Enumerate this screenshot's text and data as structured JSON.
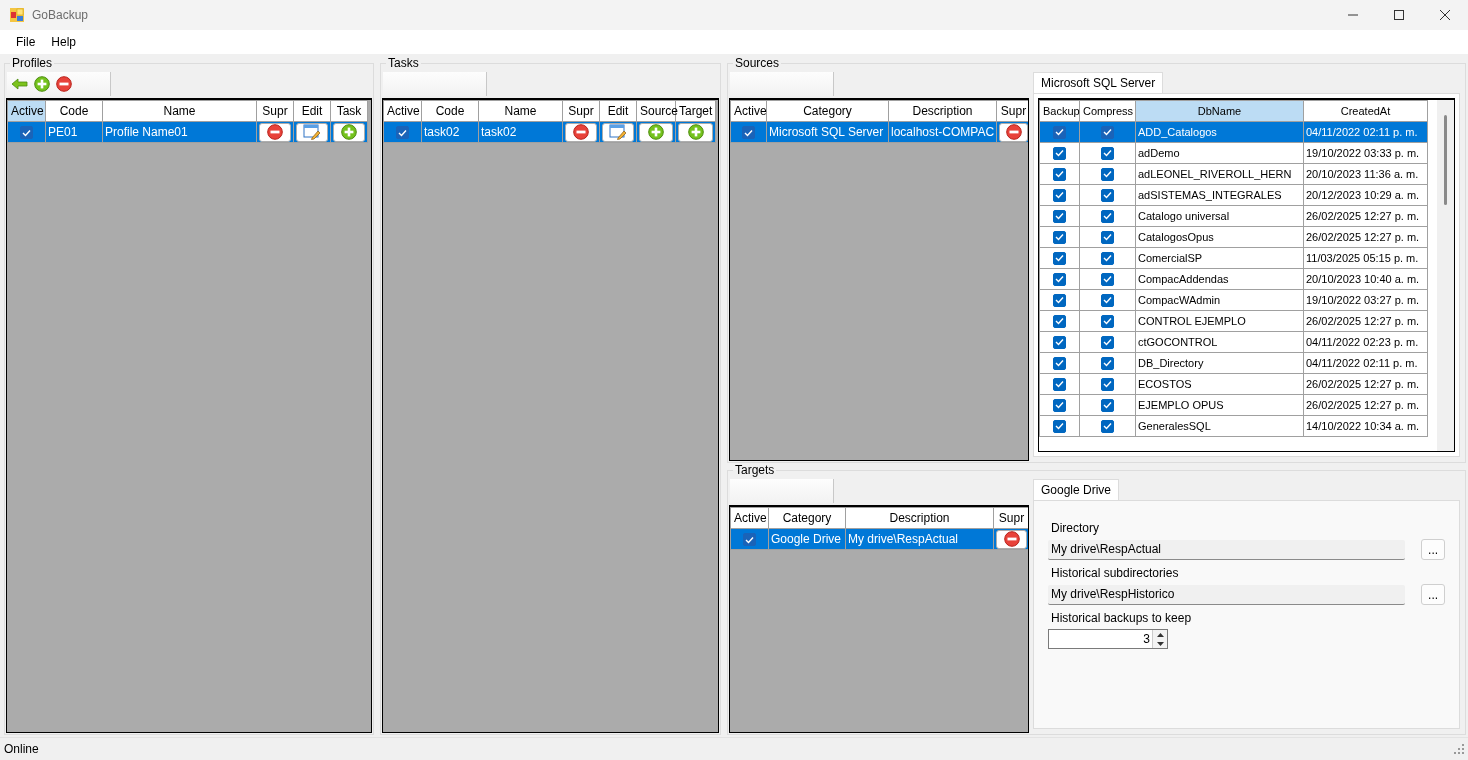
{
  "window": {
    "title": "GoBackup"
  },
  "menu": [
    {
      "label": "File"
    },
    {
      "label": "Help"
    }
  ],
  "profiles": {
    "title": "Profiles",
    "toolbar": [
      {
        "kind": "back"
      },
      {
        "kind": "add"
      },
      {
        "kind": "remove"
      }
    ],
    "columns": [
      {
        "label": "Active",
        "kind": "check",
        "highlighted": true
      },
      {
        "label": "Code",
        "kind": "text",
        "highlighted": false
      },
      {
        "label": "Name",
        "kind": "text",
        "highlighted": false
      },
      {
        "label": "Supr",
        "kind": "remove",
        "highlighted": false
      },
      {
        "label": "Edit",
        "kind": "edit",
        "highlighted": false
      },
      {
        "label": "Task",
        "kind": "add",
        "highlighted": false
      }
    ],
    "rows": [
      {
        "selected": true,
        "cells": [
          {
            "checked": true
          },
          "PE01",
          "Profile Name01"
        ]
      }
    ]
  },
  "tasks": {
    "title": "Tasks",
    "columns": [
      {
        "label": "Active",
        "kind": "check",
        "highlighted": false
      },
      {
        "label": "Code",
        "kind": "text",
        "highlighted": false
      },
      {
        "label": "Name",
        "kind": "text",
        "highlighted": false
      },
      {
        "label": "Supr",
        "kind": "remove",
        "highlighted": false
      },
      {
        "label": "Edit",
        "kind": "edit",
        "highlighted": false
      },
      {
        "label": "Source",
        "kind": "add",
        "highlighted": false
      },
      {
        "label": "Target",
        "kind": "add",
        "highlighted": false
      }
    ],
    "rows": [
      {
        "selected": true,
        "cells": [
          {
            "checked": true
          },
          "task02",
          "task02"
        ]
      }
    ]
  },
  "sources": {
    "title": "Sources",
    "columns": [
      {
        "label": "Active",
        "kind": "check",
        "highlighted": false
      },
      {
        "label": "Category",
        "kind": "text",
        "highlighted": false
      },
      {
        "label": "Description",
        "kind": "text",
        "highlighted": false
      },
      {
        "label": "Supr",
        "kind": "remove",
        "highlighted": false
      }
    ],
    "rows": [
      {
        "selected": true,
        "cells": [
          {
            "checked": true
          },
          "Microsoft SQL Server",
          "localhost-COMPAC"
        ]
      }
    ],
    "detail": {
      "tab": "Microsoft SQL Server",
      "columns": [
        {
          "label": "Backup",
          "kind": "check",
          "highlighted": false
        },
        {
          "label": "Compress",
          "kind": "check",
          "highlighted": false
        },
        {
          "label": "DbName",
          "kind": "text",
          "highlighted": true
        },
        {
          "label": "CreatedAt",
          "kind": "text",
          "highlighted": false
        }
      ],
      "rows": [
        {
          "selected": true,
          "cells": [
            {
              "checked": true
            },
            {
              "checked": true
            },
            "ADD_Catalogos",
            "04/11/2022 02:11 p. m."
          ]
        },
        {
          "selected": false,
          "cells": [
            {
              "checked": true
            },
            {
              "checked": true
            },
            "adDemo",
            "19/10/2022 03:33 p. m."
          ]
        },
        {
          "selected": false,
          "cells": [
            {
              "checked": true
            },
            {
              "checked": true
            },
            "adLEONEL_RIVEROLL_HERN",
            "20/10/2023 11:36 a. m."
          ]
        },
        {
          "selected": false,
          "cells": [
            {
              "checked": true
            },
            {
              "checked": true
            },
            "adSISTEMAS_INTEGRALES",
            "20/12/2023 10:29 a. m."
          ]
        },
        {
          "selected": false,
          "cells": [
            {
              "checked": true
            },
            {
              "checked": true
            },
            "Catalogo universal",
            "26/02/2025 12:27 p. m."
          ]
        },
        {
          "selected": false,
          "cells": [
            {
              "checked": true
            },
            {
              "checked": true
            },
            "CatalogosOpus",
            "26/02/2025 12:27 p. m."
          ]
        },
        {
          "selected": false,
          "cells": [
            {
              "checked": true
            },
            {
              "checked": true
            },
            "ComercialSP",
            "11/03/2025 05:15 p. m."
          ]
        },
        {
          "selected": false,
          "cells": [
            {
              "checked": true
            },
            {
              "checked": true
            },
            "CompacAddendas",
            "20/10/2023 10:40 a. m."
          ]
        },
        {
          "selected": false,
          "cells": [
            {
              "checked": true
            },
            {
              "checked": true
            },
            "CompacWAdmin",
            "19/10/2022 03:27 p. m."
          ]
        },
        {
          "selected": false,
          "cells": [
            {
              "checked": true
            },
            {
              "checked": true
            },
            "CONTROL EJEMPLO",
            "26/02/2025 12:27 p. m."
          ]
        },
        {
          "selected": false,
          "cells": [
            {
              "checked": true
            },
            {
              "checked": true
            },
            "ctGOCONTROL",
            "04/11/2022 02:23 p. m."
          ]
        },
        {
          "selected": false,
          "cells": [
            {
              "checked": true
            },
            {
              "checked": true
            },
            "DB_Directory",
            "04/11/2022 02:11 p. m."
          ]
        },
        {
          "selected": false,
          "cells": [
            {
              "checked": true
            },
            {
              "checked": true
            },
            "ECOSTOS",
            "26/02/2025 12:27 p. m."
          ]
        },
        {
          "selected": false,
          "cells": [
            {
              "checked": true
            },
            {
              "checked": true
            },
            "EJEMPLO OPUS",
            "26/02/2025 12:27 p. m."
          ]
        },
        {
          "selected": false,
          "cells": [
            {
              "checked": true
            },
            {
              "checked": true
            },
            "GeneralesSQL",
            "14/10/2022 10:34 a. m."
          ]
        }
      ]
    }
  },
  "targets": {
    "title": "Targets",
    "columns": [
      {
        "label": "Active",
        "kind": "check",
        "highlighted": false
      },
      {
        "label": "Category",
        "kind": "text",
        "highlighted": false
      },
      {
        "label": "Description",
        "kind": "text",
        "highlighted": false
      },
      {
        "label": "Supr",
        "kind": "remove",
        "highlighted": false
      }
    ],
    "rows": [
      {
        "selected": true,
        "cells": [
          {
            "checked": true
          },
          "Google Drive",
          "My drive\\RespActual"
        ]
      }
    ],
    "detail": {
      "tab": "Google Drive",
      "fields": [
        {
          "kind": "path",
          "label": "Directory",
          "value": "My drive\\RespActual",
          "button": "..."
        },
        {
          "kind": "path",
          "label": "Historical subdirectories",
          "value": "My drive\\RespHistorico",
          "button": "..."
        },
        {
          "kind": "number",
          "label": "Historical backups to keep",
          "value": "3"
        }
      ]
    }
  },
  "status_bar": {
    "text": "Online"
  }
}
